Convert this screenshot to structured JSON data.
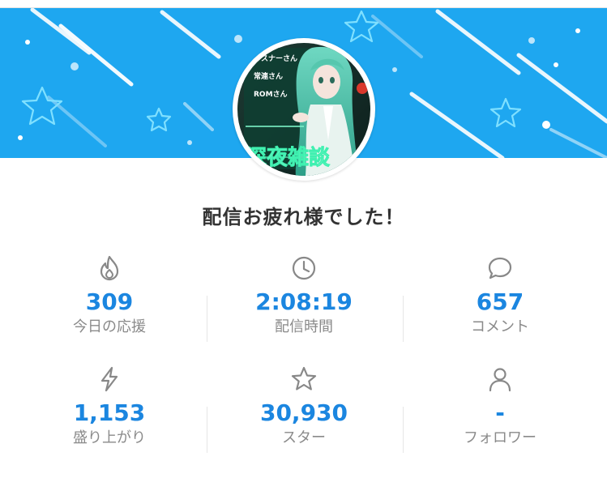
{
  "colors": {
    "banner": "#1ea7f0",
    "accent_value": "#1b86e0",
    "label": "#8a8a8a",
    "headline": "#333333",
    "icon": "#888888"
  },
  "avatar": {
    "image_text": [
      "リスナーさん",
      "常連さん",
      "ROMさん",
      "深夜雑談"
    ]
  },
  "headline": "配信お疲れ様でした！",
  "stats": [
    {
      "icon": "fire-icon",
      "value": "309",
      "label": "今日の応援"
    },
    {
      "icon": "clock-icon",
      "value": "2:08:19",
      "label": "配信時間"
    },
    {
      "icon": "speech-bubble-icon",
      "value": "657",
      "label": "コメント"
    },
    {
      "icon": "lightning-icon",
      "value": "1,153",
      "label": "盛り上がり"
    },
    {
      "icon": "star-icon",
      "value": "30,930",
      "label": "スター"
    },
    {
      "icon": "person-icon",
      "value": "-",
      "label": "フォロワー"
    }
  ]
}
